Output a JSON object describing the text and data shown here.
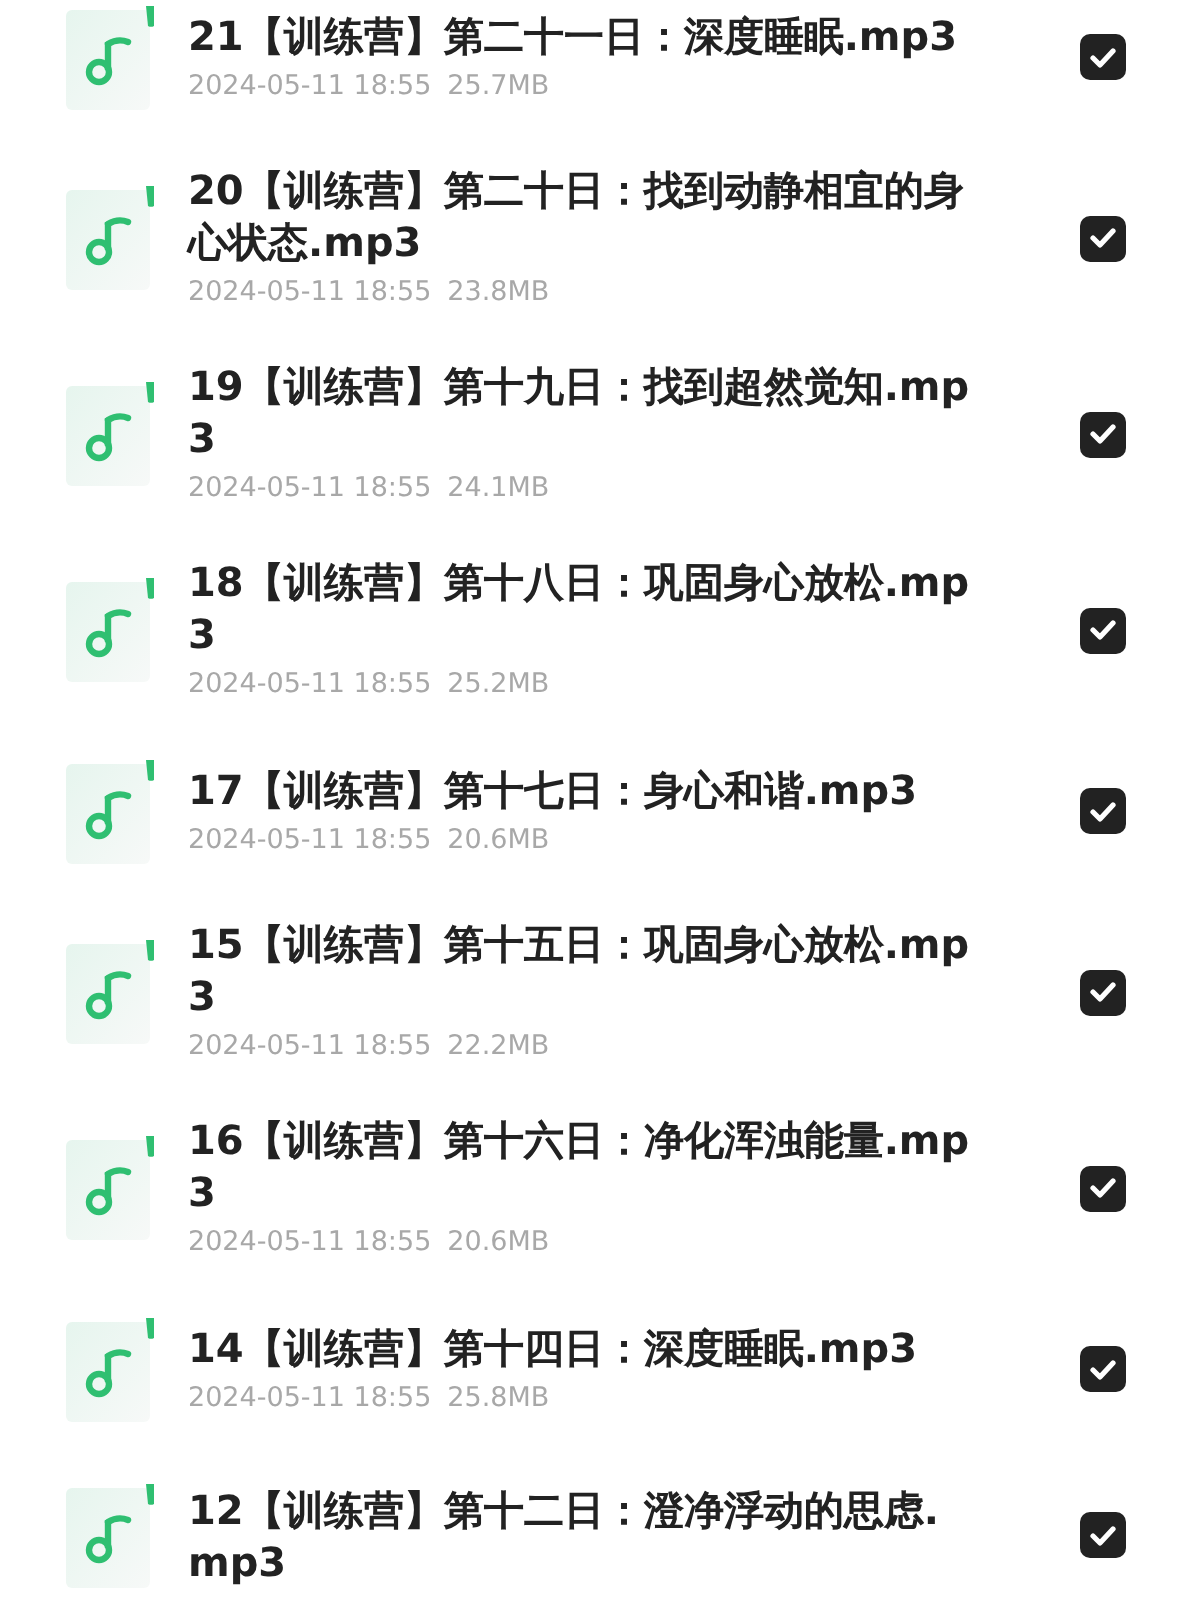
{
  "files": [
    {
      "title": "21【训练营】第二十一日：深度睡眠.mp3",
      "date": "2024-05-11 18:55",
      "size": "25.7MB",
      "checked": true
    },
    {
      "title": "20【训练营】第二十日：找到动静相宜的身心状态.mp3",
      "date": "2024-05-11 18:55",
      "size": "23.8MB",
      "checked": true
    },
    {
      "title": "19【训练营】第十九日：找到超然觉知.mp3",
      "date": "2024-05-11 18:55",
      "size": "24.1MB",
      "checked": true
    },
    {
      "title": "18【训练营】第十八日：巩固身心放松.mp3",
      "date": "2024-05-11 18:55",
      "size": "25.2MB",
      "checked": true
    },
    {
      "title": "17【训练营】第十七日：身心和谐.mp3",
      "date": "2024-05-11 18:55",
      "size": "20.6MB",
      "checked": true
    },
    {
      "title": "15【训练营】第十五日：巩固身心放松.mp3",
      "date": "2024-05-11 18:55",
      "size": "22.2MB",
      "checked": true
    },
    {
      "title": "16【训练营】第十六日：净化浑浊能量.mp3",
      "date": "2024-05-11 18:55",
      "size": "20.6MB",
      "checked": true
    },
    {
      "title": "14【训练营】第十四日：深度睡眠.mp3",
      "date": "2024-05-11 18:55",
      "size": "25.8MB",
      "checked": true
    },
    {
      "title": "12【训练营】第十二日：澄净浮动的思虑.mp3",
      "checked": true
    }
  ]
}
